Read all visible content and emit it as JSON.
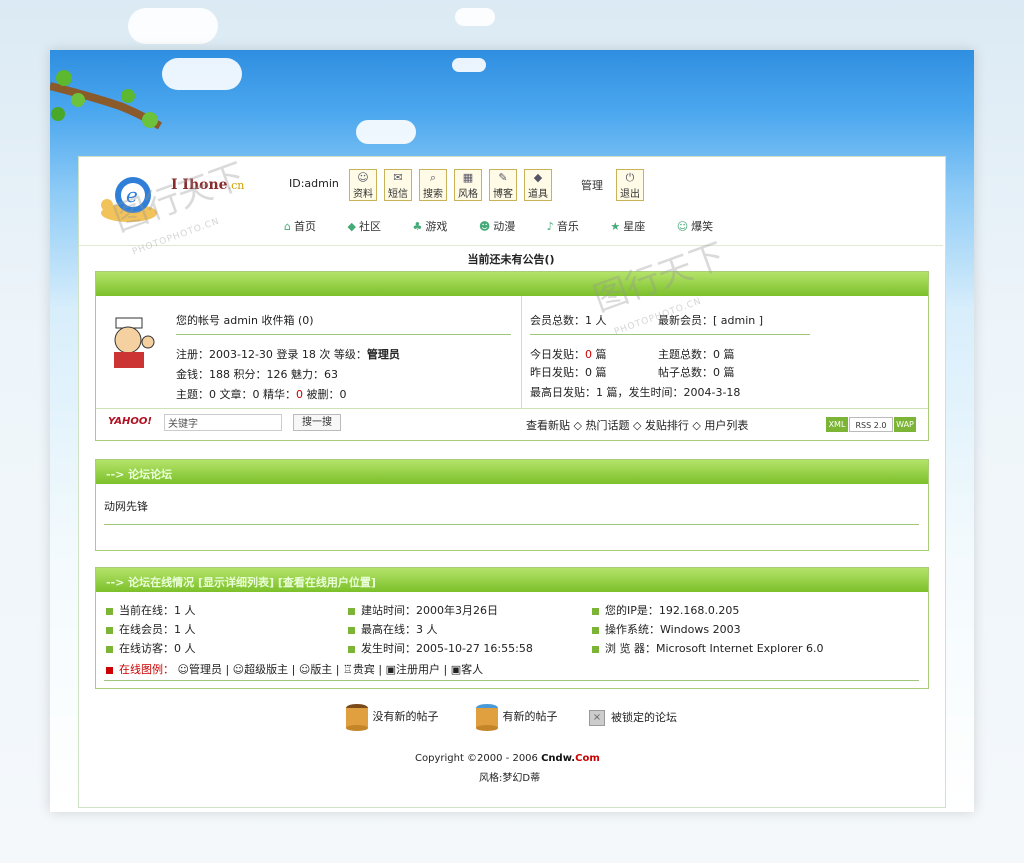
{
  "header": {
    "logo_text": "I Ihone",
    "logo_suffix": ".cn",
    "user_id": "ID:admin",
    "toolbar": [
      "资料",
      "短信",
      "搜索",
      "风格",
      "博客",
      "道具"
    ],
    "manage_label": "管理",
    "logout_label": "退出",
    "nav": [
      "首页",
      "社区",
      "游戏",
      "动漫",
      "音乐",
      "星座",
      "爆笑"
    ]
  },
  "notice": "当前还未有公告()",
  "user_panel": {
    "account_line": "您的帐号 admin 收件箱 (0)",
    "reg_line": "注册：2003-12-30 登录 18 次 等级：",
    "rank": "管理员",
    "money_line": "金钱：188 积分：126 魅力：63",
    "posts_prefix": "主题：0 文章：0 精华：",
    "posts_digest": "0",
    "posts_suffix": " 被删：0"
  },
  "stats": {
    "members_total": "会员总数：1 人",
    "newest_member": "最新会员：[ admin ]",
    "today_posts_label": "今日发贴：",
    "today_posts_value": "0",
    "today_posts_unit": " 篇",
    "topics_total": "主题总数：0 篇",
    "yesterday_posts": "昨日发贴：0 篇",
    "posts_total": "帖子总数：0 篇",
    "max_day": "最高日发贴：1 篇，发生时间：2004-3-18"
  },
  "search_bar": {
    "yahoo_logo": "YAHOO!",
    "placeholder": "关键字",
    "button": "搜一搜",
    "links": [
      "查看新贴",
      "热门话题",
      "发贴排行",
      "用户列表"
    ],
    "badges": [
      "XML",
      "RSS 2.0",
      "WAP"
    ]
  },
  "forum_section": {
    "title": "--> 论坛论坛",
    "item": "动网先锋"
  },
  "online_section": {
    "title": "--> 论坛在线情况 [显示详细列表] [查看在线用户位置]",
    "col1": [
      "当前在线：1 人",
      "在线会员：1 人",
      "在线访客：0 人"
    ],
    "col2": [
      "建站时间：2000年3月26日",
      "最高在线：3 人",
      "发生时间：2005-10-27 16:55:58"
    ],
    "col3": [
      "您的IP是：192.168.0.205",
      "操作系统：Windows 2003",
      "浏 览 器：Microsoft Internet Explorer 6.0"
    ],
    "legend_label": "在线图例：",
    "legend": [
      "管理员",
      "超级版主",
      "版主",
      "贵宾",
      "注册用户",
      "客人"
    ]
  },
  "legend_bottom": [
    "没有新的帖子",
    "有新的帖子",
    "被锁定的论坛"
  ],
  "footer": {
    "copyright_prefix": "Copyright ©2000 - 2006 ",
    "copyright_brand": "Cndw.",
    "copyright_brand2": "Com",
    "style": "风格:梦幻D蒂"
  },
  "watermark": {
    "main": "图行天下",
    "sub": "PHOTOPHOTO.CN"
  }
}
